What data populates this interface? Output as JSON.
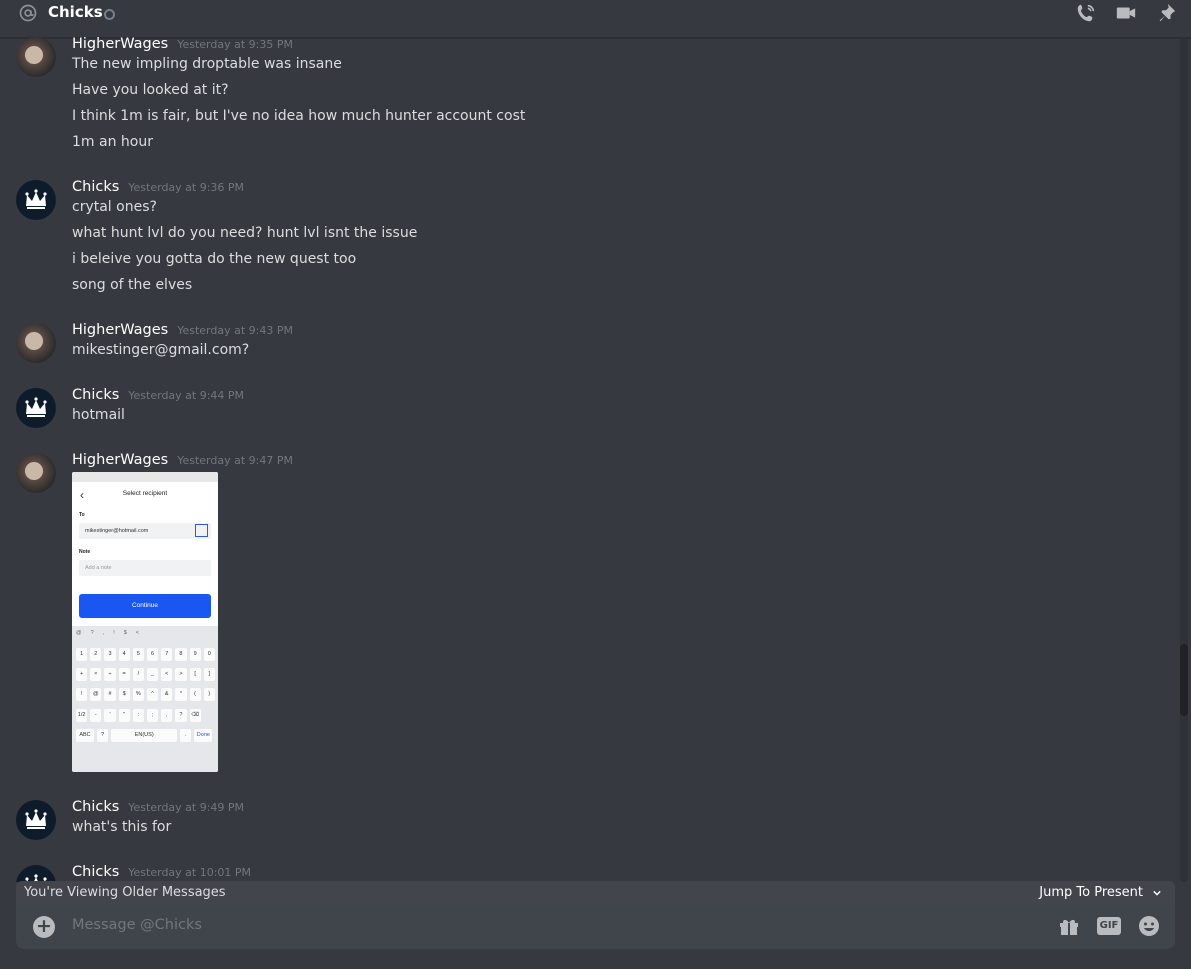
{
  "header": {
    "channel_name": "Chicks",
    "icons": [
      "at-icon",
      "status-idle-dot",
      "voice-call-icon",
      "video-call-icon",
      "pin-icon"
    ]
  },
  "messages": [
    {
      "author": "HigherWages",
      "time": "Yesterday at 9:35 PM",
      "lines": [
        "The new impling droptable was insane",
        "Have you looked at it?",
        "I think 1m is fair, but I've no idea how much hunter account cost",
        "1m an hour"
      ]
    },
    {
      "author": "Chicks",
      "time": "Yesterday at 9:36 PM",
      "lines": [
        "crytal ones?",
        "what hunt lvl do you need? hunt lvl isnt the issue",
        "i beleive you gotta do the new quest too",
        "song of the elves"
      ]
    },
    {
      "author": "HigherWages",
      "time": "Yesterday at 9:43 PM",
      "lines": [
        "mikestinger@gmail.com?"
      ]
    },
    {
      "author": "Chicks",
      "time": "Yesterday at 9:44 PM",
      "lines": [
        "hotmail"
      ]
    },
    {
      "author": "HigherWages",
      "time": "Yesterday at 9:47 PM",
      "attachment": {
        "title": "Select recipient",
        "to_label": "To",
        "to_value": "mikestinger@hotmail.com",
        "note_label": "Note",
        "note_placeholder": "Add a note",
        "button": "Continue",
        "kb_symbols": [
          "@",
          "?",
          ",",
          "!",
          "$",
          "<"
        ],
        "kb_rows": [
          [
            "1",
            "2",
            "3",
            "4",
            "5",
            "6",
            "7",
            "8",
            "9",
            "0"
          ],
          [
            "+",
            "×",
            "÷",
            "=",
            "/",
            "_",
            "<",
            ">",
            "[",
            "]"
          ],
          [
            "!",
            "@",
            "#",
            "$",
            "%",
            "^",
            "&",
            "*",
            "(",
            ")"
          ],
          [
            "1/2",
            "-",
            "'",
            "\"",
            ":",
            ";",
            ",",
            "?",
            "⌫"
          ]
        ],
        "kb_bottom": [
          "ABC",
          "?",
          "EN(US)",
          ".",
          "Done"
        ]
      }
    },
    {
      "author": "Chicks",
      "time": "Yesterday at 9:49 PM",
      "lines": [
        "what's this for"
      ]
    },
    {
      "author": "Chicks",
      "time": "Yesterday at 10:01 PM",
      "lines": []
    }
  ],
  "older_bar": {
    "text": "You're Viewing Older Messages",
    "jump": "Jump To Present"
  },
  "composer": {
    "placeholder": "Message @Chicks",
    "gif_label": "GIF"
  }
}
